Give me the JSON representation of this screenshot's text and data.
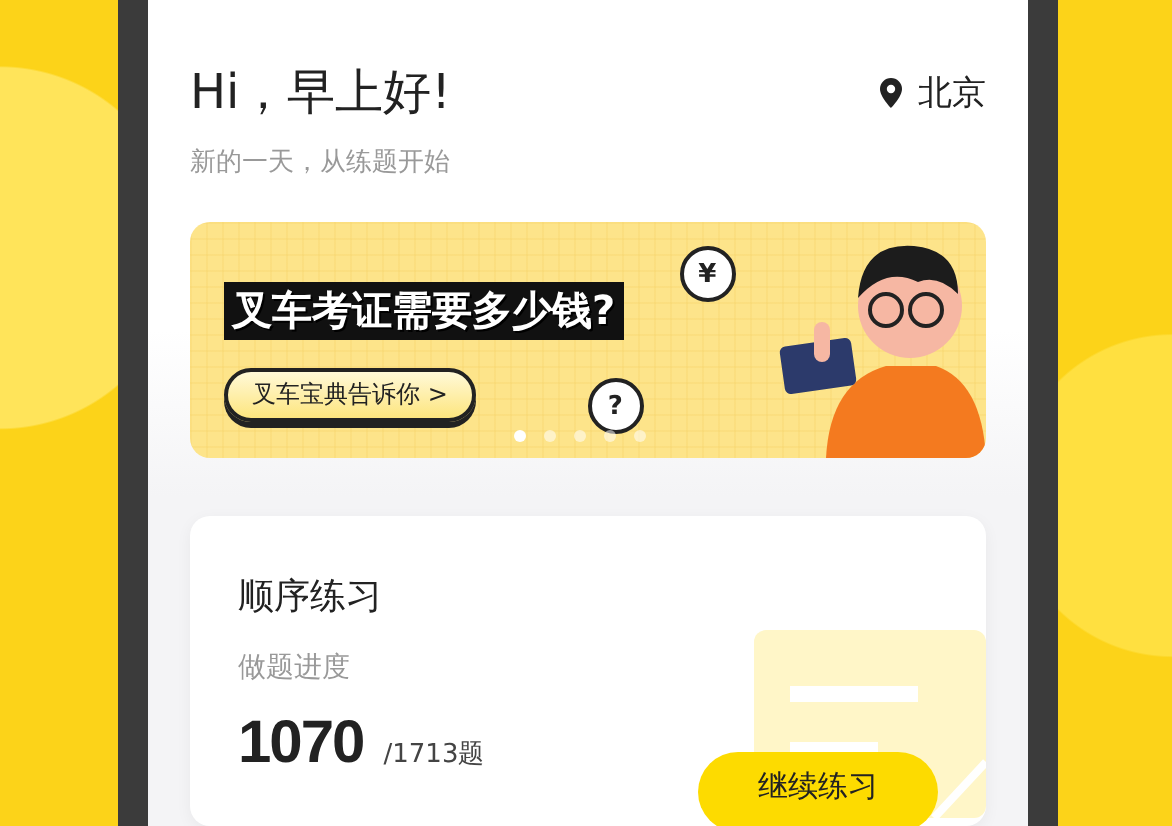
{
  "header": {
    "greeting": "Hi，早上好!",
    "location": "北京",
    "subtitle": "新的一天，从练题开始"
  },
  "banner": {
    "headline": "叉车考证需要多少钱?",
    "cta": "叉车宝典告诉你 >",
    "bubbles": [
      "¥",
      "?"
    ],
    "dots": [
      {
        "selected": true
      },
      {
        "selected": false
      },
      {
        "selected": false
      },
      {
        "selected": false
      },
      {
        "selected": false
      }
    ]
  },
  "practice_card": {
    "title": "顺序练习",
    "progress_label": "做题进度",
    "done": "1070",
    "total": "/1713题",
    "button": "继续练习"
  }
}
